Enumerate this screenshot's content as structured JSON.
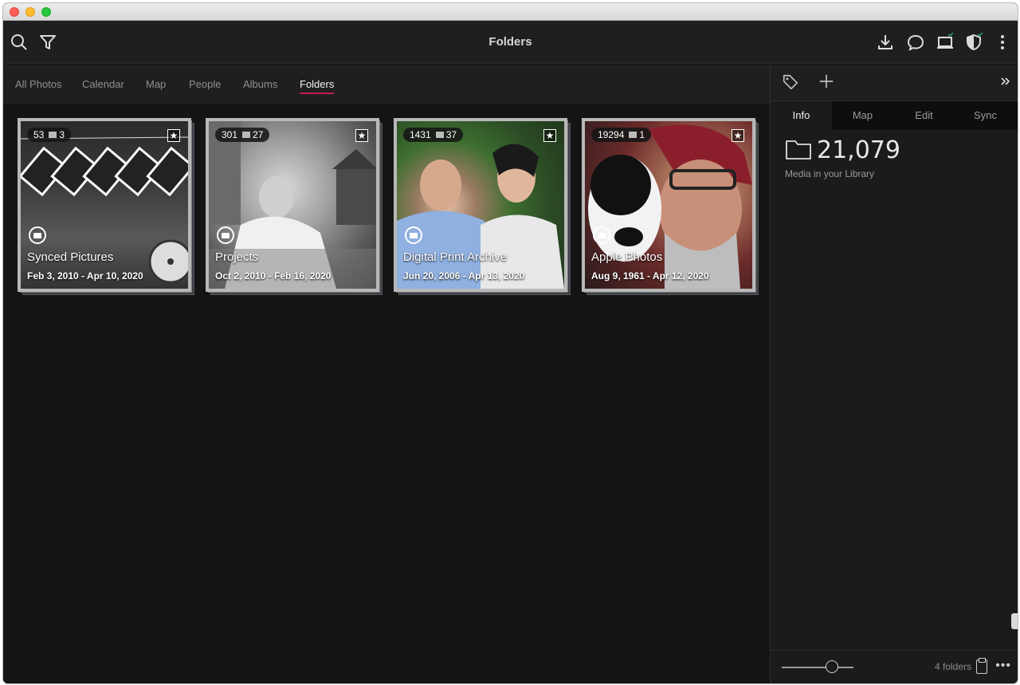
{
  "toolbar": {
    "title": "Folders"
  },
  "tabs": [
    {
      "label": "All Photos"
    },
    {
      "label": "Calendar"
    },
    {
      "label": "Map"
    },
    {
      "label": "People"
    },
    {
      "label": "Albums"
    },
    {
      "label": "Folders"
    }
  ],
  "active_tab": "Folders",
  "folders": [
    {
      "name": "Synced Pictures",
      "date_range": "Feb 3, 2010 - Apr 10, 2020",
      "photo_count": "53",
      "subfolder_count": "3"
    },
    {
      "name": "Projects",
      "date_range": "Oct 2, 2010 - Feb 16, 2020",
      "photo_count": "301",
      "subfolder_count": "27"
    },
    {
      "name": "Digital Print Archive",
      "date_range": "Jun 20, 2006 - Apr 13, 2020",
      "photo_count": "1431",
      "subfolder_count": "37"
    },
    {
      "name": "Apple Photos",
      "date_range": "Aug 9, 1961 - Apr 12, 2020",
      "photo_count": "19294",
      "subfolder_count": "1"
    }
  ],
  "panel": {
    "tabs": [
      {
        "label": "Info"
      },
      {
        "label": "Map"
      },
      {
        "label": "Edit"
      },
      {
        "label": "Sync"
      }
    ],
    "active_tab": "Info",
    "media_count": "21,079",
    "media_label": "Media in your Library",
    "folders_count": "4 folders",
    "zoom_level": 0.7
  },
  "colors": {
    "accent": "#c2185b",
    "background": "#141414"
  },
  "icons": [
    "search-icon",
    "filter-icon",
    "import-icon",
    "comment-icon",
    "laptop-icon",
    "shield-icon",
    "more-vertical-icon",
    "tag-icon",
    "add-icon",
    "collapse-icon",
    "folder-icon",
    "clipboard-icon",
    "more-horizontal-icon",
    "star-icon"
  ]
}
